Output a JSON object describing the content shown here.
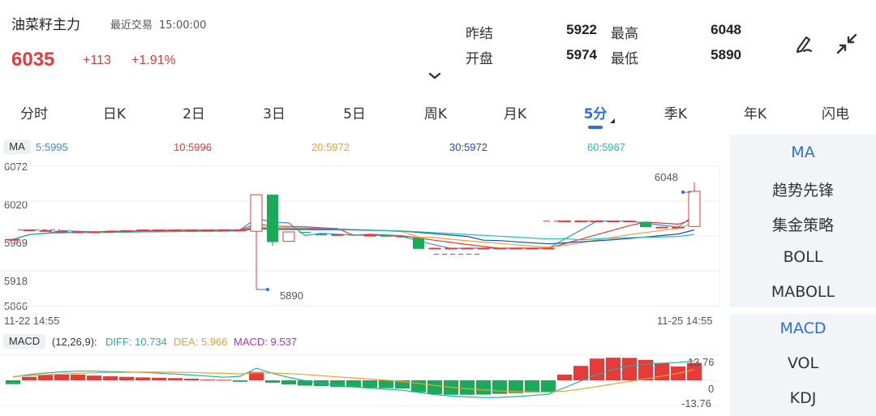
{
  "header": {
    "title": "油菜籽主力",
    "last_trade_label": "最近交易",
    "last_trade_time": "15:00:00",
    "price": "6035",
    "change": "+113",
    "change_pct": "+1.91%",
    "stats": {
      "prev_settle_label": "昨结",
      "prev_settle": "5922",
      "high_label": "最高",
      "high": "6048",
      "open_label": "开盘",
      "open": "5974",
      "low_label": "最低",
      "low": "5890"
    },
    "icons": {
      "draw": "pen-draw-icon",
      "fullscreen": "collapse-arrows-icon"
    }
  },
  "tabs": [
    {
      "label": "分时"
    },
    {
      "label": "日K"
    },
    {
      "label": "2日"
    },
    {
      "label": "3日"
    },
    {
      "label": "5日"
    },
    {
      "label": "周K"
    },
    {
      "label": "月K"
    },
    {
      "label": "5分",
      "active": true
    },
    {
      "label": "季K"
    },
    {
      "label": "年K"
    },
    {
      "label": "闪电"
    }
  ],
  "ma_legend": {
    "tag": "MA",
    "ma5": "5:5995",
    "ma10": "10:5996",
    "ma20": "20:5972",
    "ma30": "30:5972",
    "ma60": "60:5967",
    "colors": {
      "ma5": "#3a8fd8",
      "ma10": "#e8393b",
      "ma20": "#f0a030",
      "ma30": "#1a4fc0",
      "ma60": "#20c0b0"
    }
  },
  "price_axis": [
    "6072",
    "6020",
    "5969",
    "5918",
    "5866"
  ],
  "time_axis": {
    "start": "11-22 14:55",
    "end": "11-25 14:55"
  },
  "annotations": {
    "high": "6048",
    "low": "5890"
  },
  "macd_legend": {
    "tag": "MACD",
    "params": "(12,26,9):",
    "diff": "DIFF: 10.734",
    "dea": "DEA: 5.966",
    "macd": "MACD: 9.537"
  },
  "macd_axis": {
    "top": "13.76",
    "zero": "0",
    "bottom": "-13.76"
  },
  "side_panel": {
    "main_indicators": [
      "MA",
      "趋势先锋",
      "集金策略",
      "BOLL",
      "MABOLL"
    ],
    "sub_indicators": [
      "MACD",
      "VOL",
      "KDJ"
    ]
  },
  "chart_data": {
    "type": "candlestick",
    "ylim": [
      5866,
      6072
    ],
    "candles": [
      {
        "open": 5964,
        "close": 5964,
        "high": 5964,
        "low": 5964
      },
      {
        "open": 5978,
        "close": 5978,
        "high": 5978,
        "low": 5978
      },
      {
        "open": 5977,
        "close": 5977,
        "high": 5977,
        "low": 5977
      },
      {
        "open": 5976,
        "close": 5976,
        "high": 5976,
        "low": 5976
      },
      {
        "open": 5975,
        "close": 5975,
        "high": 5975,
        "low": 5975
      },
      {
        "open": 5975,
        "close": 5975,
        "high": 5975,
        "low": 5975
      },
      {
        "open": 5976,
        "close": 5976,
        "high": 5976,
        "low": 5976
      },
      {
        "open": 5977,
        "close": 5977,
        "high": 5977,
        "low": 5977
      },
      {
        "open": 5978,
        "close": 5978,
        "high": 5978,
        "low": 5978
      },
      {
        "open": 5978,
        "close": 5978,
        "high": 5978,
        "low": 5978
      },
      {
        "open": 5978,
        "close": 5978,
        "high": 5978,
        "low": 5978
      },
      {
        "open": 5978,
        "close": 5978,
        "high": 5978,
        "low": 5978
      },
      {
        "open": 5978,
        "close": 5978,
        "high": 5978,
        "low": 5978
      },
      {
        "open": 5978,
        "close": 5978,
        "high": 5978,
        "low": 5978
      },
      {
        "open": 5978,
        "close": 5978,
        "high": 5978,
        "low": 5978
      },
      {
        "open": 5976,
        "close": 6030,
        "high": 6030,
        "low": 5890
      },
      {
        "open": 6030,
        "close": 5960,
        "high": 6030,
        "low": 5954
      },
      {
        "open": 5961,
        "close": 5975,
        "high": 5975,
        "low": 5961
      },
      {
        "open": 5975,
        "close": 5974,
        "high": 5975,
        "low": 5974
      },
      {
        "open": 5972,
        "close": 5970,
        "high": 5972,
        "low": 5970
      },
      {
        "open": 5970,
        "close": 5971,
        "high": 5971,
        "low": 5970
      },
      {
        "open": 5971,
        "close": 5970,
        "high": 5971,
        "low": 5970
      },
      {
        "open": 5970,
        "close": 5970,
        "high": 5970,
        "low": 5970
      },
      {
        "open": 5970,
        "close": 5968,
        "high": 5970,
        "low": 5968
      },
      {
        "open": 5968,
        "close": 5967,
        "high": 5968,
        "low": 5967
      },
      {
        "open": 5966,
        "close": 5950,
        "high": 5966,
        "low": 5950
      },
      {
        "open": 5951,
        "close": 5951,
        "high": 5951,
        "low": 5951
      },
      {
        "open": 5951,
        "close": 5951,
        "high": 5951,
        "low": 5951
      },
      {
        "open": 5951,
        "close": 5951,
        "high": 5951,
        "low": 5951
      },
      {
        "open": 5951,
        "close": 5951,
        "high": 5951,
        "low": 5951
      },
      {
        "open": 5951,
        "close": 5951,
        "high": 5951,
        "low": 5951
      },
      {
        "open": 5951,
        "close": 5951,
        "high": 5951,
        "low": 5951
      },
      {
        "open": 5951,
        "close": 5951,
        "high": 5951,
        "low": 5951
      },
      {
        "open": 5951,
        "close": 5951,
        "high": 5951,
        "low": 5951
      },
      {
        "open": 5991,
        "close": 5991,
        "high": 5991,
        "low": 5991
      },
      {
        "open": 5991,
        "close": 5991,
        "high": 5991,
        "low": 5991
      },
      {
        "open": 5991,
        "close": 5991,
        "high": 5991,
        "low": 5991
      },
      {
        "open": 5991,
        "close": 5991,
        "high": 5991,
        "low": 5991
      },
      {
        "open": 5991,
        "close": 5991,
        "high": 5991,
        "low": 5991
      },
      {
        "open": 5990,
        "close": 5982,
        "high": 5990,
        "low": 5982
      },
      {
        "open": 5982,
        "close": 5982,
        "high": 5982,
        "low": 5982
      },
      {
        "open": 5982,
        "close": 5982,
        "high": 5982,
        "low": 5982
      },
      {
        "open": 5983,
        "close": 6035,
        "high": 6048,
        "low": 5983
      }
    ],
    "macd_bars": [
      -2.1,
      1.9,
      2.9,
      3.1,
      3.1,
      2.6,
      2.2,
      1.9,
      1.6,
      1.4,
      1.2,
      0.9,
      0.4,
      0.3,
      -0.8,
      4.6,
      -1.3,
      -2.3,
      -2.9,
      -3.2,
      -3.6,
      -3.8,
      -4.1,
      -4.3,
      -4.5,
      -6.5,
      -7.6,
      -7.9,
      -7.9,
      -7.8,
      -7.4,
      -7.0,
      -6.7,
      -6.3,
      3.1,
      7.9,
      11.9,
      12.4,
      12.3,
      11.2,
      9.5,
      7.6,
      9.537
    ],
    "diff_line": [
      1.8,
      3.1,
      4.0,
      4.6,
      5.0,
      5.0,
      4.8,
      4.6,
      4.3,
      3.9,
      3.4,
      2.9,
      2.3,
      1.7,
      2.2,
      6.6,
      3.8,
      1.6,
      -0.2,
      -1.6,
      -2.7,
      -3.6,
      -4.3,
      -4.9,
      -5.4,
      -6.6,
      -7.8,
      -8.6,
      -9.1,
      -9.4,
      -9.3,
      -8.9,
      -8.3,
      -7.6,
      -4.0,
      -0.4,
      3.2,
      5.9,
      7.8,
      8.8,
      9.4,
      9.7,
      10.734
    ],
    "dea_line": [
      2.1,
      2.6,
      3.0,
      3.4,
      3.8,
      4.1,
      4.3,
      4.4,
      4.5,
      4.5,
      4.4,
      4.3,
      4.0,
      3.8,
      3.5,
      4.1,
      4.0,
      3.7,
      3.2,
      2.5,
      1.9,
      1.3,
      0.7,
      0.1,
      -0.6,
      -1.7,
      -2.8,
      -3.8,
      -4.6,
      -5.3,
      -5.8,
      -6.1,
      -6.3,
      -6.5,
      -5.9,
      -4.8,
      -3.4,
      -2.0,
      -0.6,
      0.8,
      2.3,
      3.8,
      5.966
    ],
    "macd_ylim": [
      -13.76,
      13.76
    ]
  }
}
